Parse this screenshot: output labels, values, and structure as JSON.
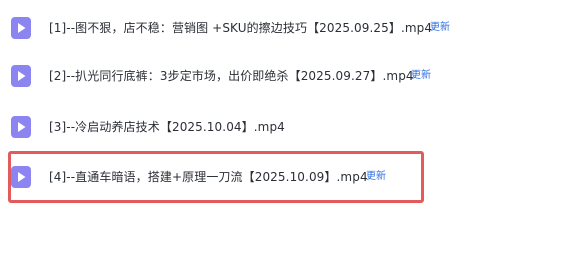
{
  "files": [
    {
      "name": "[1]--图不狠，店不稳：营销图 +SKU的擦边技巧【2025.09.25】.mp4",
      "badge": "更新",
      "icon": "video-file-icon"
    },
    {
      "name": "[2]--扒光同行底裤：3步定市场，出价即绝杀【2025.09.27】.mp4",
      "badge": "更新",
      "icon": "video-file-icon"
    },
    {
      "name": "[3]--冷启动养店技术【2025.10.04】.mp4",
      "badge": "",
      "icon": "video-file-icon"
    },
    {
      "name": "[4]--直通车暗语，搭建+原理一刀流【2025.10.09】.mp4",
      "badge": "更新",
      "icon": "video-file-icon"
    }
  ],
  "colors": {
    "icon": "#8c84f0",
    "badge": "#2f6fe0",
    "highlight": "#e35b5b"
  }
}
